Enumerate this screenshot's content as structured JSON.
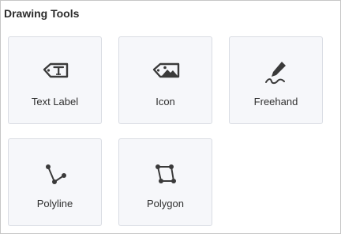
{
  "panel": {
    "title": "Drawing Tools"
  },
  "tools": [
    {
      "label": "Text Label",
      "icon": "text-tag-icon"
    },
    {
      "label": "Icon",
      "icon": "image-tag-icon"
    },
    {
      "label": "Freehand",
      "icon": "pen-squiggle-icon"
    },
    {
      "label": "Polyline",
      "icon": "polyline-icon"
    },
    {
      "label": "Polygon",
      "icon": "polygon-icon"
    }
  ],
  "colors": {
    "icon": "#3a3a3a",
    "card_background": "#f6f7fa",
    "card_border": "#d9dce3",
    "text": "#2f2f2f"
  }
}
